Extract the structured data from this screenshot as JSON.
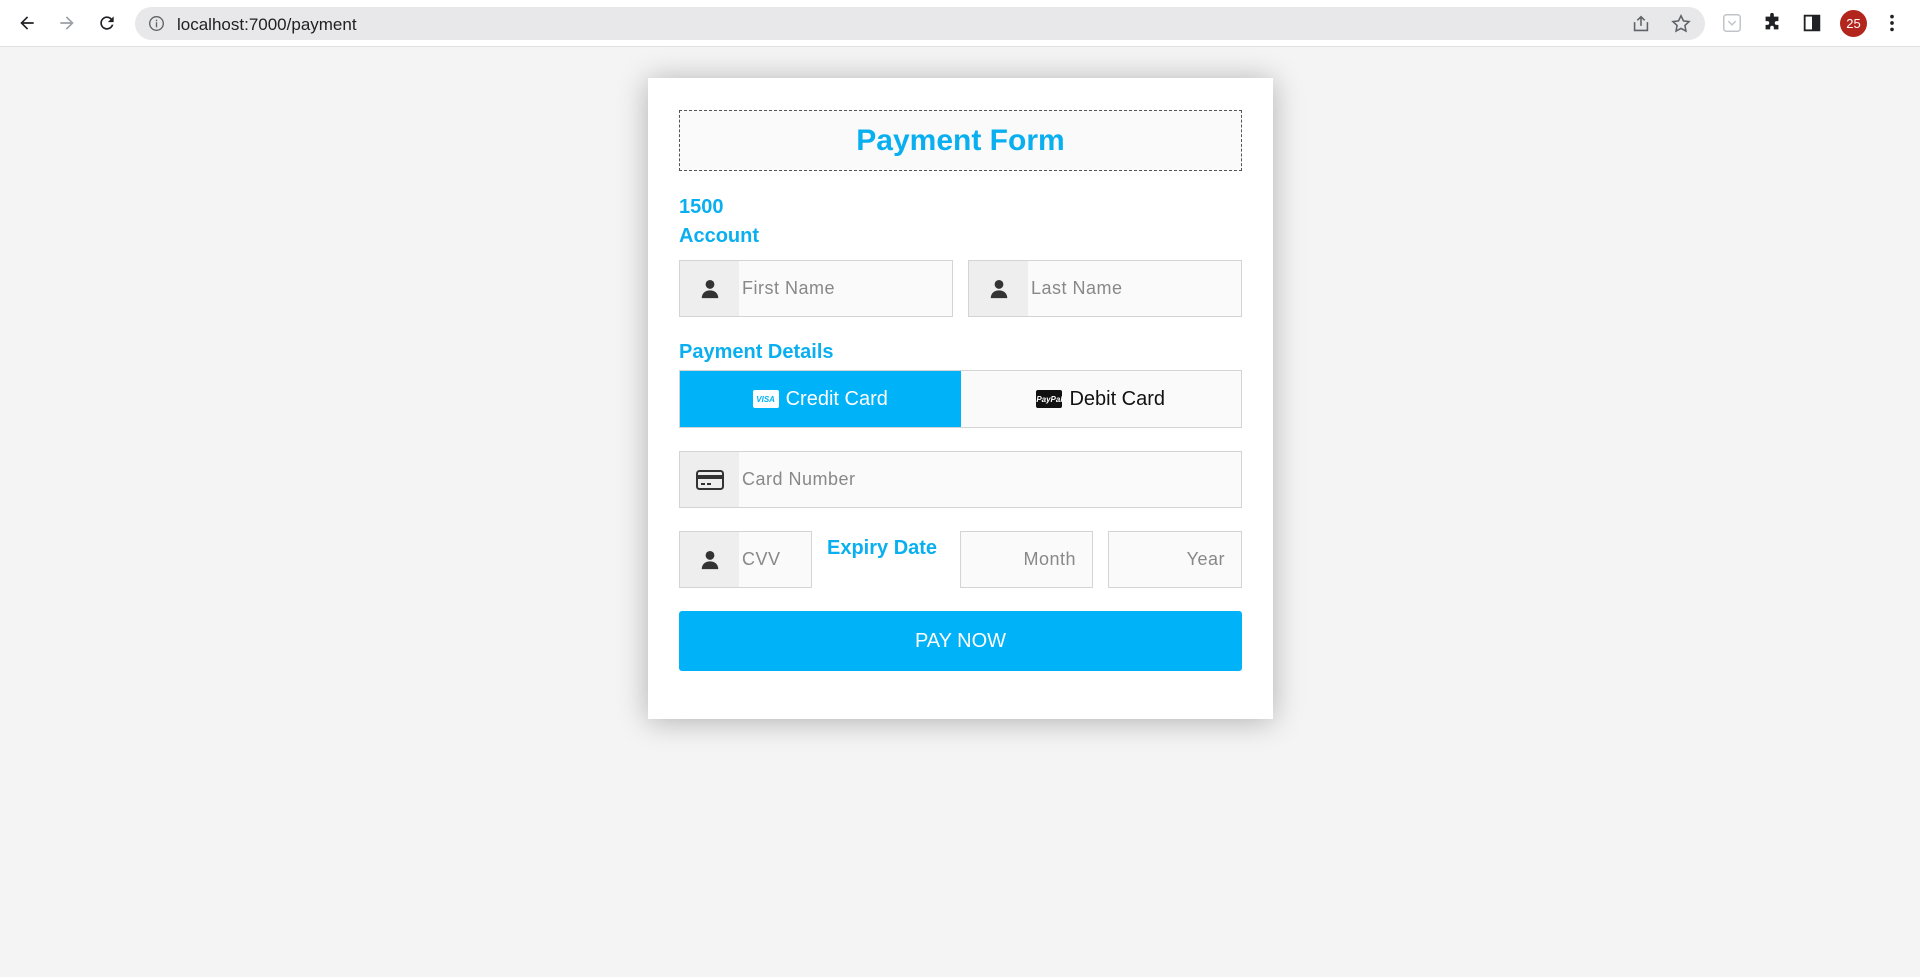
{
  "browser": {
    "url": "localhost:7000/payment",
    "profile_initials": "25"
  },
  "form": {
    "title": "Payment Form",
    "amount": "1500",
    "account_label": "Account",
    "first_name_placeholder": "First Name",
    "last_name_placeholder": "Last Name",
    "payment_details_label": "Payment Details",
    "payment_methods": [
      {
        "label": "Credit Card",
        "icon": "visa-icon",
        "brand_text": "VISA",
        "selected": true
      },
      {
        "label": "Debit Card",
        "icon": "paypal-icon",
        "brand_text": "PayPal",
        "selected": false
      }
    ],
    "card_number_placeholder": "Card Number",
    "cvv_placeholder": "CVV",
    "expiry_label": "Expiry Date",
    "month_placeholder": "Month",
    "year_placeholder": "Year",
    "pay_button_label": "PAY NOW"
  },
  "colors": {
    "accent": "#0aaff0",
    "button": "#00b2f7",
    "page_background": "#f4f4f4",
    "profile_badge": "#b3261e"
  }
}
